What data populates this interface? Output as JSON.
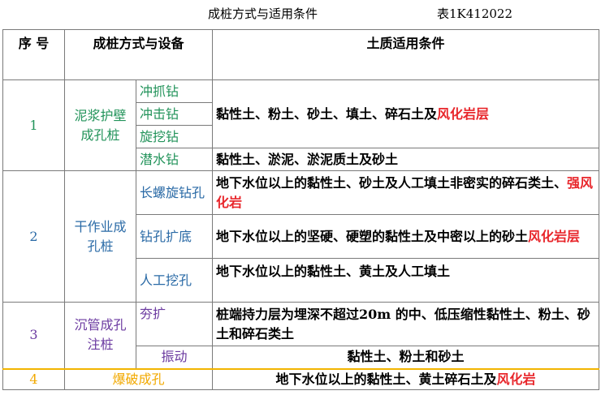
{
  "caption": {
    "title": "成桩方式与适用条件",
    "code": "表1K412022"
  },
  "header": {
    "no": "序 号",
    "method": "成桩方式与设备",
    "soil": "土质适用条件"
  },
  "colors": {
    "highlight": "#e8262b",
    "group1": "#22935a",
    "group2": "#2a6aa6",
    "group3": "#6b3aa0",
    "group4": "#f2a900"
  },
  "rows": {
    "g1": {
      "no": "1",
      "name": "泥浆护壁成孔桩",
      "eq": [
        "冲抓钻",
        "冲击钻",
        "旋挖钻",
        "潜水钻"
      ],
      "soil_a": "黏性土、粉土、砂土、填土、碎石土及",
      "soil_a_hl": "风化岩层",
      "soil_b": "黏性土、淤泥、淤泥质土及砂土"
    },
    "g2": {
      "no": "2",
      "name": "干作业成孔桩",
      "eq": [
        "长螺旋钻孔",
        "钻孔扩底",
        "人工挖孔"
      ],
      "soil_a": "地下水位以上的黏性土、砂土及人工填土非密实的碎石类土、",
      "soil_a_hl": "强风化岩",
      "soil_b": "地下水位以上的坚硬、硬塑的黏性土及中密以上的砂土",
      "soil_b_hl": "风化岩层",
      "soil_c": "地下水位以上的黏性土、黄土及人工填土"
    },
    "g3": {
      "no": "3",
      "name": "沉管成孔注桩",
      "eq": [
        "夯扩",
        "振动"
      ],
      "soil_a": "桩端持力层为埋深不超过20m 的中、低压缩性黏性土、粉土、砂土和碎石类土",
      "soil_b": "黏性土、粉土和砂土"
    },
    "g4": {
      "no": "4",
      "name": "爆破成孔",
      "soil": "地下水位以上的黏性土、黄土碎石土及",
      "soil_hl": "风化岩"
    }
  }
}
